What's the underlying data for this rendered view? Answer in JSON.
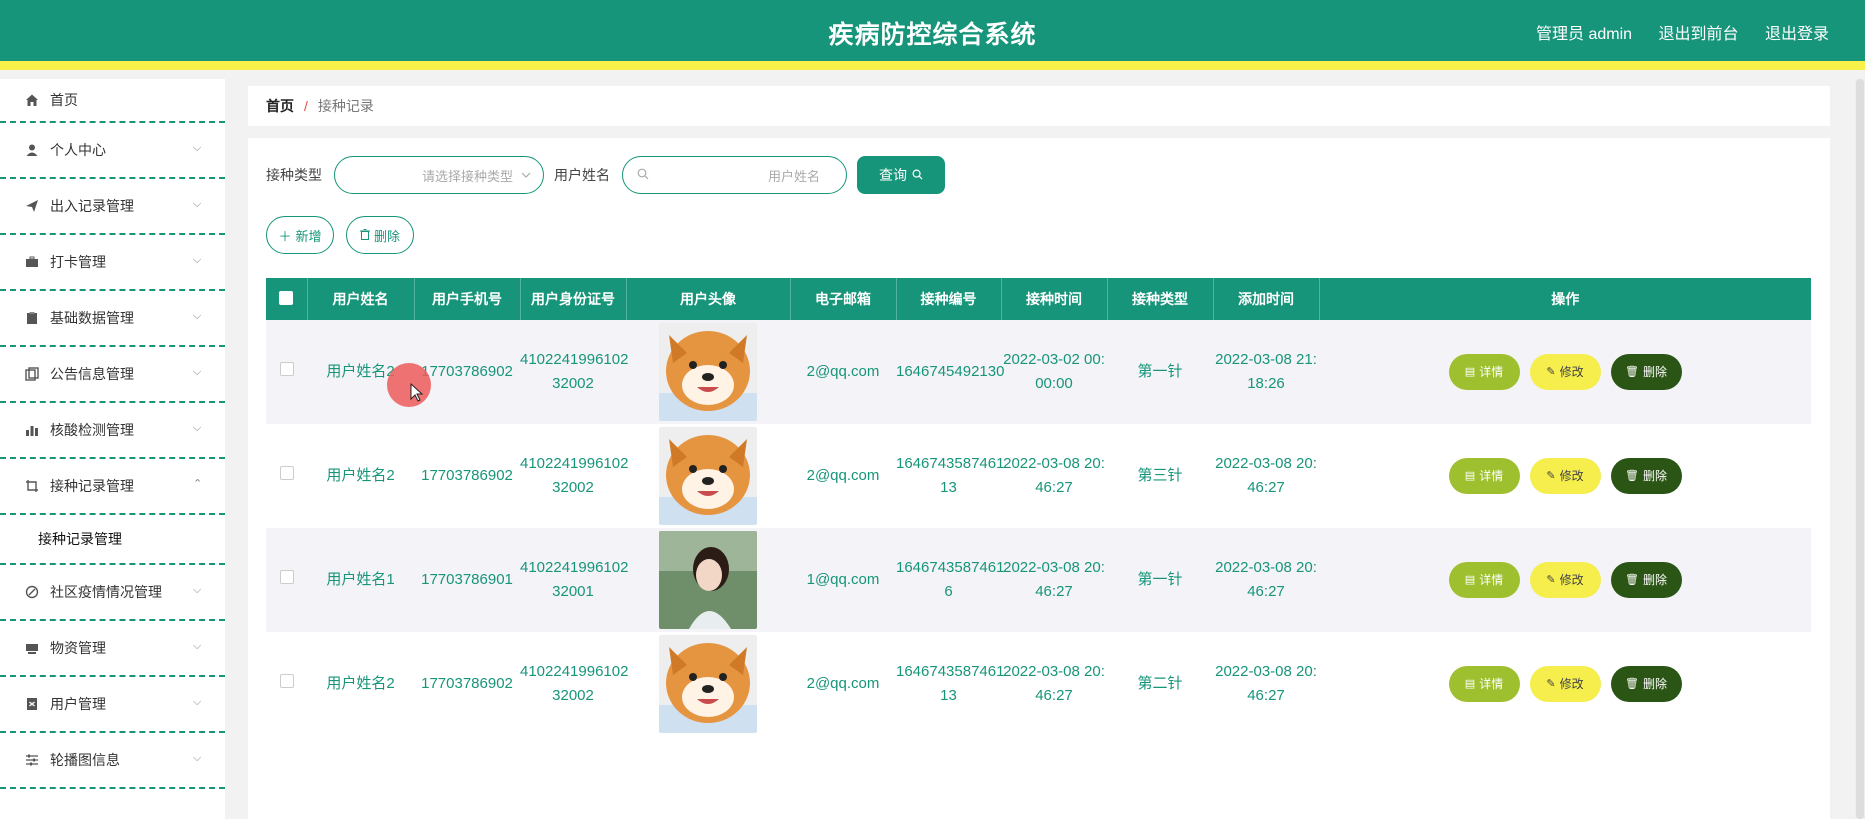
{
  "header": {
    "title": "疾病防控综合系统",
    "admin": "管理员 admin",
    "to_front": "退出到前台",
    "logout": "退出登录"
  },
  "sidebar": {
    "items": [
      {
        "label": "首页",
        "icon": "home-icon"
      },
      {
        "label": "个人中心",
        "icon": "user-icon"
      },
      {
        "label": "出入记录管理",
        "icon": "send-icon"
      },
      {
        "label": "打卡管理",
        "icon": "briefcase-icon"
      },
      {
        "label": "基础数据管理",
        "icon": "clipboard-icon"
      },
      {
        "label": "公告信息管理",
        "icon": "copy-icon"
      },
      {
        "label": "核酸检测管理",
        "icon": "bar-chart-icon"
      },
      {
        "label": "接种记录管理",
        "icon": "crop-icon"
      },
      {
        "label": "社区疫情情况管理",
        "icon": "compass-icon"
      },
      {
        "label": "物资管理",
        "icon": "box-icon"
      },
      {
        "label": "用户管理",
        "icon": "id-card-icon"
      },
      {
        "label": "轮播图信息",
        "icon": "sliders-icon"
      }
    ],
    "sub_item": "接种记录管理"
  },
  "breadcrumb": {
    "home": "首页",
    "separator": "/",
    "current": "接种记录"
  },
  "search": {
    "type_label": "接种类型",
    "type_placeholder": "请选择接种类型",
    "name_label": "用户姓名",
    "name_placeholder": "用户姓名",
    "query_label": "查询"
  },
  "actions": {
    "add_label": "新增",
    "delete_label": "删除"
  },
  "table": {
    "columns": [
      "用户姓名",
      "用户手机号",
      "用户身份证号",
      "用户头像",
      "电子邮箱",
      "接种编号",
      "接种时间",
      "接种类型",
      "添加时间",
      "操作"
    ],
    "rows": [
      {
        "name": "用户姓名2",
        "phone": "17703786902",
        "id1": "4102241996102",
        "id2": "32002",
        "avatar": "dog",
        "email": "2@qq.com",
        "code1": "1646745492130",
        "code2": "",
        "time1": "2022-03-02 00:",
        "time2": "00:00",
        "type": "第一针",
        "added1": "2022-03-08 21:",
        "added2": "18:26"
      },
      {
        "name": "用户姓名2",
        "phone": "17703786902",
        "id1": "4102241996102",
        "id2": "32002",
        "avatar": "dog",
        "email": "2@qq.com",
        "code1": "1646743587461",
        "code2": "13",
        "time1": "2022-03-08 20:",
        "time2": "46:27",
        "type": "第三针",
        "added1": "2022-03-08 20:",
        "added2": "46:27"
      },
      {
        "name": "用户姓名1",
        "phone": "17703786901",
        "id1": "4102241996102",
        "id2": "32001",
        "avatar": "girl",
        "email": "1@qq.com",
        "code1": "1646743587461",
        "code2": "6",
        "time1": "2022-03-08 20:",
        "time2": "46:27",
        "type": "第一针",
        "added1": "2022-03-08 20:",
        "added2": "46:27"
      },
      {
        "name": "用户姓名2",
        "phone": "17703786902",
        "id1": "4102241996102",
        "id2": "32002",
        "avatar": "dog",
        "email": "2@qq.com",
        "code1": "1646743587461",
        "code2": "13",
        "time1": "2022-03-08 20:",
        "time2": "46:27",
        "type": "第二针",
        "added1": "2022-03-08 20:",
        "added2": "46:27"
      }
    ],
    "op_detail": "详情",
    "op_edit": "修改",
    "op_delete": "删除"
  },
  "colors": {
    "primary": "#17957a",
    "accent_yellow": "#f7f14a",
    "detail_btn": "#9ec02f",
    "edit_btn": "#f5ee4c",
    "delete_btn": "#2a5514"
  }
}
